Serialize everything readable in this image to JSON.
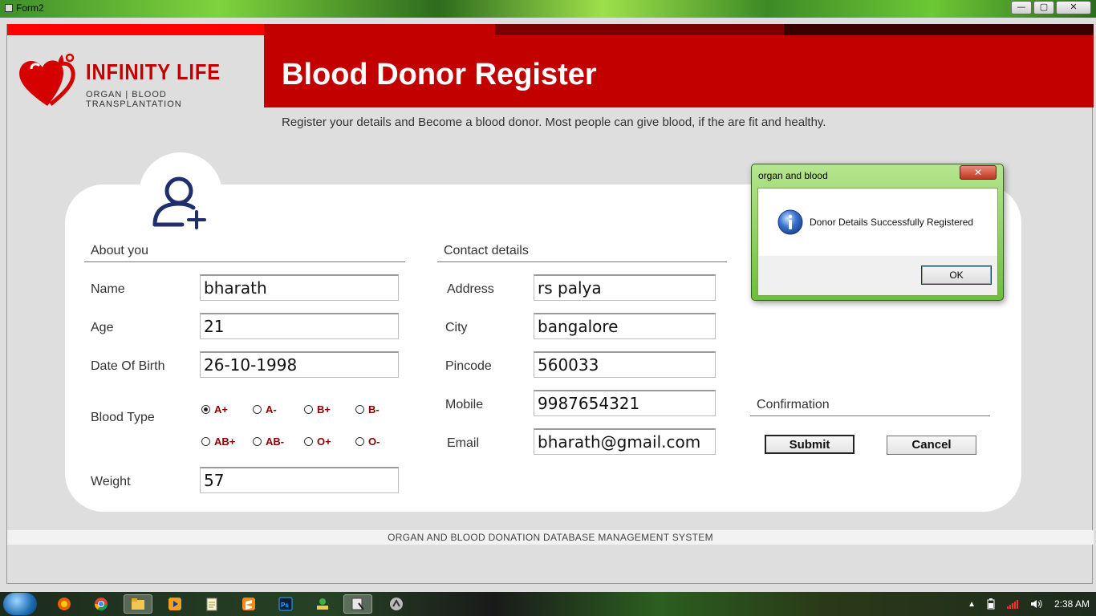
{
  "window": {
    "title": "Form2",
    "minimize": "—",
    "maximize": "▢",
    "close": "✕"
  },
  "brand": {
    "name": "INFINITY LIFE",
    "tagline": "ORGAN | BLOOD  TRANSPLANTATION",
    "color": "#c30000"
  },
  "header": {
    "title": "Blood Donor Register"
  },
  "subtitle": "Register your details and Become a blood donor. Most people can give blood, if the are fit and healthy.",
  "about": {
    "heading": "About you",
    "name_label": "Name",
    "name_value": "bharath",
    "age_label": "Age",
    "age_value": "21",
    "dob_label": "Date Of Birth",
    "dob_value": "26-10-1998",
    "blood_label": "Blood Type",
    "blood_types": [
      "A+",
      "A-",
      "B+",
      "B-",
      "AB+",
      "AB-",
      "O+",
      "O-"
    ],
    "blood_selected": "A+",
    "weight_label": "Weight",
    "weight_value": "57"
  },
  "contact": {
    "heading": "Contact details",
    "address_label": "Address",
    "address_value": "rs palya",
    "city_label": "City",
    "city_value": "bangalore",
    "pincode_label": "Pincode",
    "pincode_value": "560033",
    "mobile_label": "Mobile",
    "mobile_value": "9987654321",
    "email_label": "Email",
    "email_value": "bharath@gmail.com"
  },
  "confirmation": {
    "heading": "Confirmation",
    "submit": "Submit",
    "cancel": "Cancel"
  },
  "footer": "ORGAN AND BLOOD DONATION DATABASE MANAGEMENT SYSTEM",
  "dialog": {
    "title": "organ and blood",
    "close": "✕",
    "message": "Donor Details Successfully Registered",
    "ok": "OK",
    "icon": "info-icon"
  },
  "taskbar": {
    "time": "2:38 AM",
    "show_hidden": "▲"
  }
}
